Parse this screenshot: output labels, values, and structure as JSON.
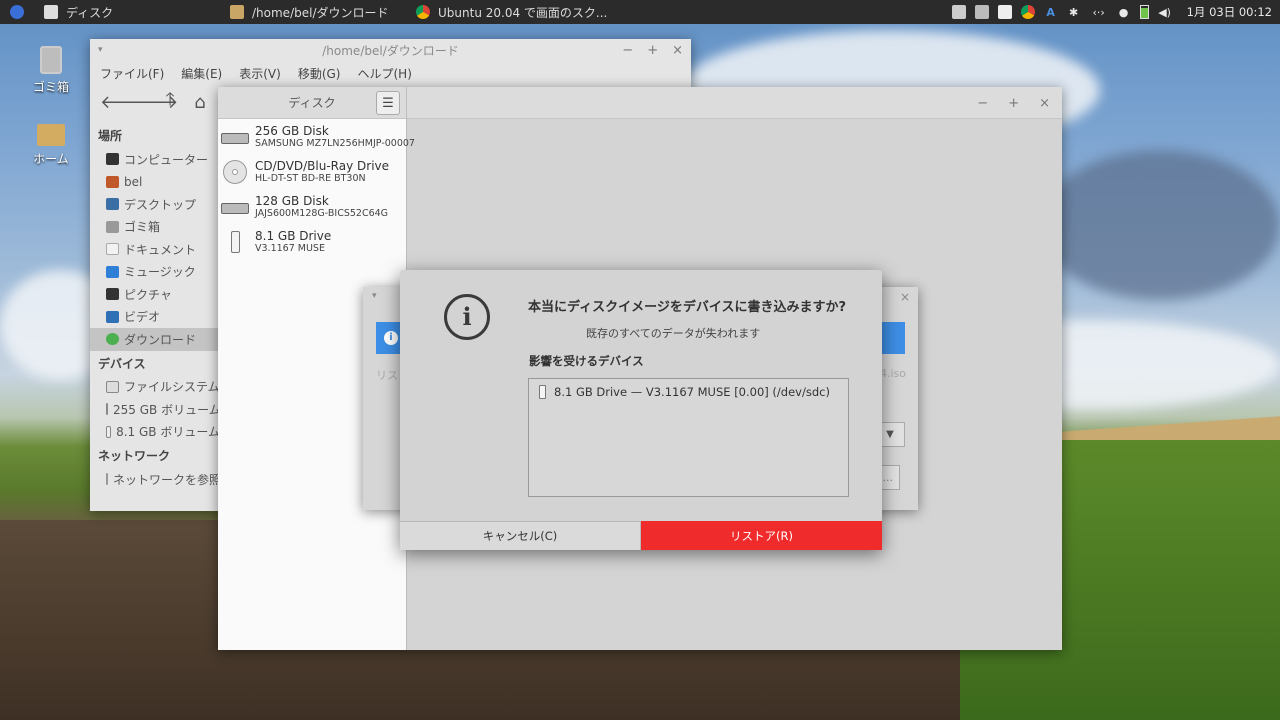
{
  "panel": {
    "tasks": [
      {
        "label": "ディスク"
      },
      {
        "label": "/home/bel/ダウンロード"
      },
      {
        "label": "Ubuntu 20.04 で画面のスク..."
      }
    ],
    "tray_letter": "A",
    "clock": "1月 03日 00:12"
  },
  "desktop": {
    "trash_label": "ゴミ箱",
    "home_label": "ホーム"
  },
  "file_manager": {
    "title": "/home/bel/ダウンロード",
    "menu": [
      "ファイル(F)",
      "編集(E)",
      "表示(V)",
      "移動(G)",
      "ヘルプ(H)"
    ],
    "places_header": "場所",
    "places": [
      "コンピューター",
      "bel",
      "デスクトップ",
      "ゴミ箱",
      "ドキュメント",
      "ミュージック",
      "ピクチャ",
      "ビデオ",
      "ダウンロード"
    ],
    "devices_header": "デバイス",
    "devices": [
      "ファイルシステム",
      "255 GB ボリューム",
      "8.1 GB ボリューム"
    ],
    "network_header": "ネットワーク",
    "network": [
      "ネットワークを参照"
    ]
  },
  "disks": {
    "title": "ディスク",
    "drives": [
      {
        "name": "256 GB Disk",
        "model": "SAMSUNG MZ7LN256HMJP-00007",
        "icon": "hdd-icon"
      },
      {
        "name": "CD/DVD/Blu-Ray Drive",
        "model": "HL-DT-ST BD-RE BT30N",
        "icon": "optical-drive-icon"
      },
      {
        "name": "128 GB Disk",
        "model": "JAJS600M128G-BICS52C64G",
        "icon": "hdd-icon"
      },
      {
        "name": "8.1 GB Drive",
        "model": "V3.1167 MUSE",
        "icon": "usb-drive-icon"
      }
    ]
  },
  "restore_dialog": {
    "partial_label": "リス",
    "partial_file": "4.iso",
    "partial_button": "..."
  },
  "confirm_dialog": {
    "title": "本当にディスクイメージをデバイスに書き込みますか?",
    "subtitle": "既存のすべてのデータが失われます",
    "affected_label": "影響を受けるデバイス",
    "device": "8.1 GB Drive — V3.1167 MUSE [0.00] (/dev/sdc)",
    "cancel_label": "キャンセル(C)",
    "restore_label": "リストア(R)",
    "restore_color": "#ef2b2b"
  }
}
